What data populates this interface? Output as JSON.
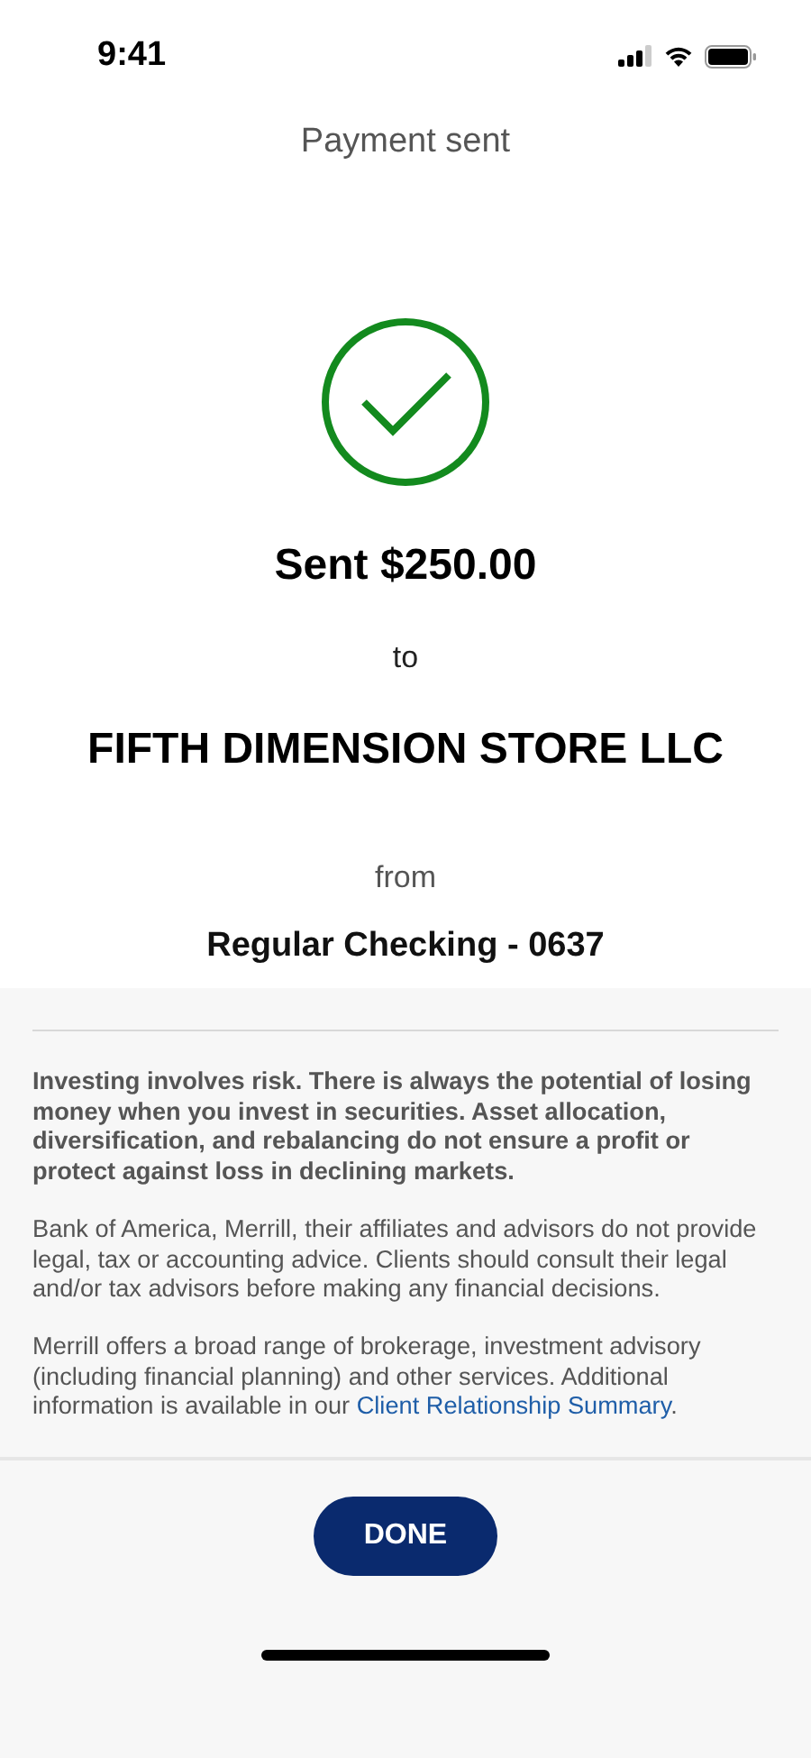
{
  "status_bar": {
    "time": "9:41"
  },
  "title": "Payment sent",
  "confirmation": {
    "amount": "Sent $250.00",
    "to_label": "to",
    "payee": "FIFTH DIMENSION STORE LLC",
    "from_label": "from",
    "account": "Regular Checking - 0637"
  },
  "disclosures": [
    {
      "kind": "bold",
      "text": "Investing involves risk. There is always the potential of losing money when you invest in securities. Asset allocation, diversification, and rebalancing do not ensure a profit or protect against loss in declining markets."
    },
    {
      "kind": "plain",
      "text": "Bank of America, Merrill, their affiliates and advisors do not provide legal, tax or accounting advice. Clients should consult their legal and/or tax advisors before making any financial decisions."
    },
    {
      "kind": "link",
      "text": "Merrill offers a broad range of brokerage, investment advisory (including financial planning) and other services. Additional information is available in our ",
      "link": "Client Relationship Summary",
      "after": "."
    }
  ],
  "done_button": "DONE"
}
